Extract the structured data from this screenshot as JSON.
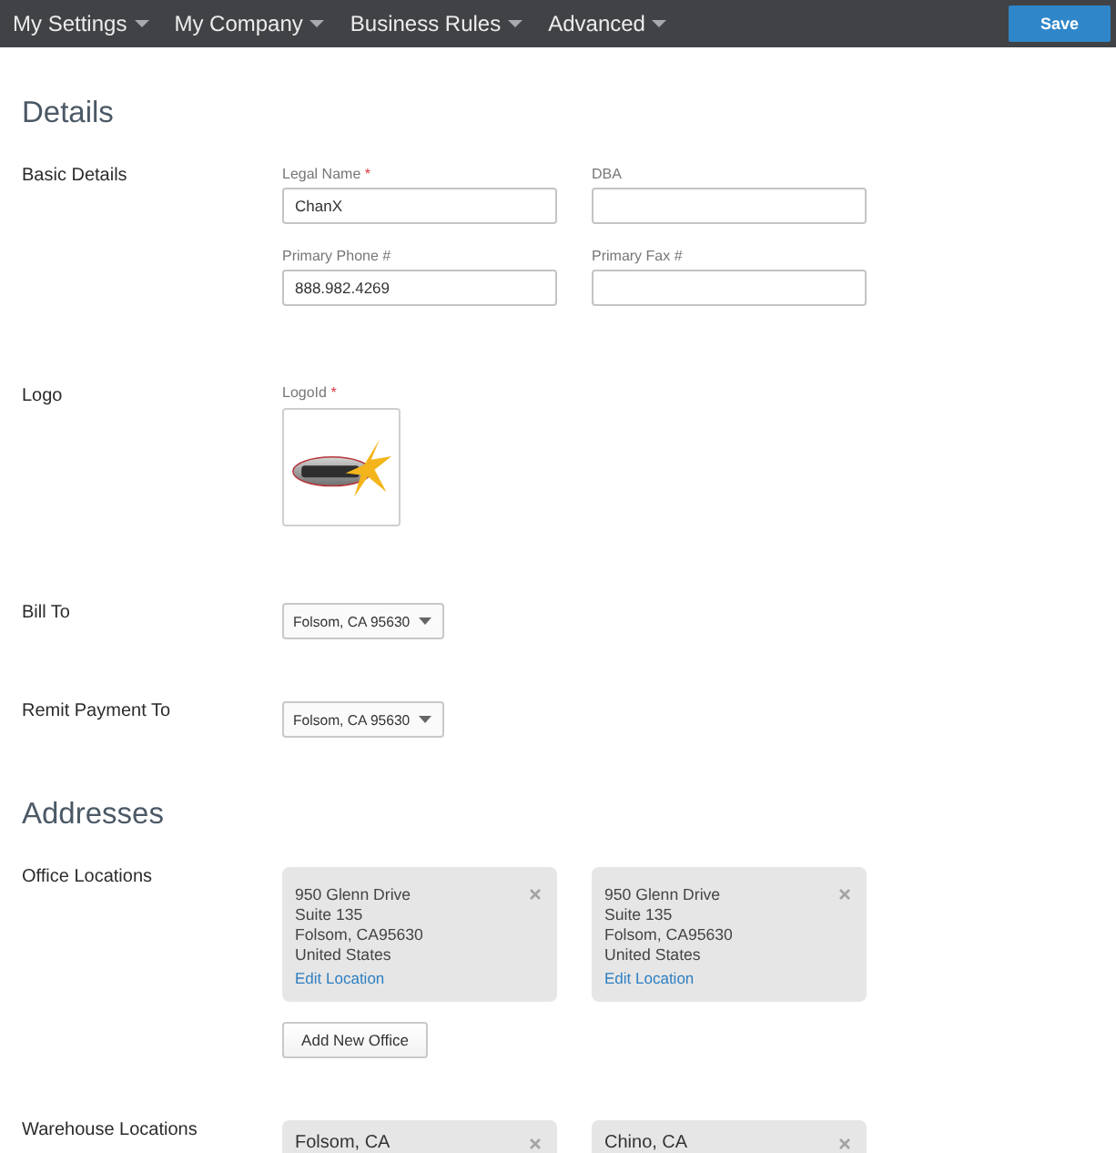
{
  "nav": {
    "menus": [
      {
        "label": "My Settings"
      },
      {
        "label": "My Company"
      },
      {
        "label": "Business Rules"
      },
      {
        "label": "Advanced"
      }
    ],
    "save_button": "Save"
  },
  "sections": [
    {
      "heading": "Details",
      "rows": [
        {
          "kind": "fields",
          "label": "Basic Details",
          "fields": [
            {
              "label": "Legal Name",
              "required_mark": "*",
              "value": "ChanX"
            },
            {
              "label": "DBA"
            },
            {
              "label": "Primary Phone #",
              "value": "888.982.4269"
            },
            {
              "label": "Primary Fax #"
            }
          ]
        },
        {
          "kind": "logo",
          "label": "Logo",
          "field_label": "LogoId",
          "required_mark": "*"
        },
        {
          "kind": "select",
          "label": "Bill To",
          "value": "Folsom, CA 95630"
        },
        {
          "kind": "select",
          "label": "Remit Payment To",
          "value": "Folsom, CA 95630"
        }
      ]
    },
    {
      "heading": "Addresses",
      "rows": [
        {
          "kind": "cards",
          "label": "Office Locations",
          "cards": [
            {
              "kind": "address",
              "lines": [
                "950 Glenn Drive",
                "Suite 135",
                "Folsom, CA95630",
                "United States"
              ],
              "link": "Edit Location"
            },
            {
              "kind": "address",
              "lines": [
                "950 Glenn Drive",
                "Suite 135",
                "Folsom, CA95630",
                "United States"
              ],
              "link": "Edit Location"
            }
          ],
          "add_button": "Add New Office"
        },
        {
          "kind": "cards",
          "label": "Warehouse Locations",
          "cards": [
            {
              "kind": "name",
              "title": "Folsom, CA"
            },
            {
              "kind": "name",
              "title": "Chino, CA"
            }
          ]
        }
      ]
    }
  ]
}
